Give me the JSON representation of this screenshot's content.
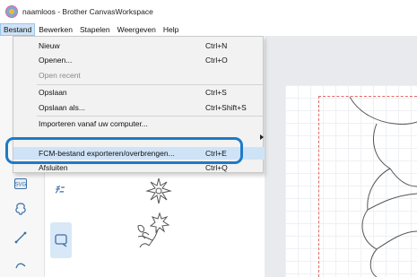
{
  "window": {
    "title": "naamloos - Brother CanvasWorkspace",
    "logo_icon": "canvasworkspace-logo-icon"
  },
  "menubar": {
    "items": [
      "Bestand",
      "Bewerken",
      "Stapelen",
      "Weergeven",
      "Help"
    ],
    "active": "Bestand"
  },
  "file_menu": {
    "items": [
      {
        "label": "Nieuw",
        "shortcut": "Ctrl+N",
        "enabled": true
      },
      {
        "label": "Openen...",
        "shortcut": "Ctrl+O",
        "enabled": true
      },
      {
        "label": "Open recent",
        "shortcut": "",
        "enabled": false
      },
      {
        "label": "Opslaan",
        "shortcut": "Ctrl+S",
        "enabled": true
      },
      {
        "label": "Opslaan als...",
        "shortcut": "Ctrl+Shift+S",
        "enabled": true
      },
      {
        "label": "Importeren vanaf uw computer...",
        "shortcut": "",
        "enabled": true
      },
      {
        "label": "",
        "shortcut": "",
        "enabled": true,
        "submenu": true
      },
      {
        "label": "FCM-bestand exporteren/overbrengen...",
        "shortcut": "Ctrl+E",
        "enabled": true,
        "selected": true
      },
      {
        "label": "Afsluiten",
        "shortcut": "Ctrl+Q",
        "enabled": true
      }
    ]
  },
  "highlight_color": "#1e7ac8",
  "toolbar": {
    "icons": [
      "svg-import-icon",
      "shape-icon",
      "line-icon",
      "curve-icon"
    ]
  },
  "library": {
    "icons": [
      "text-icon",
      "flower-pattern-icon",
      "flower-stem-pattern-icon",
      "select-tile-icon"
    ]
  }
}
